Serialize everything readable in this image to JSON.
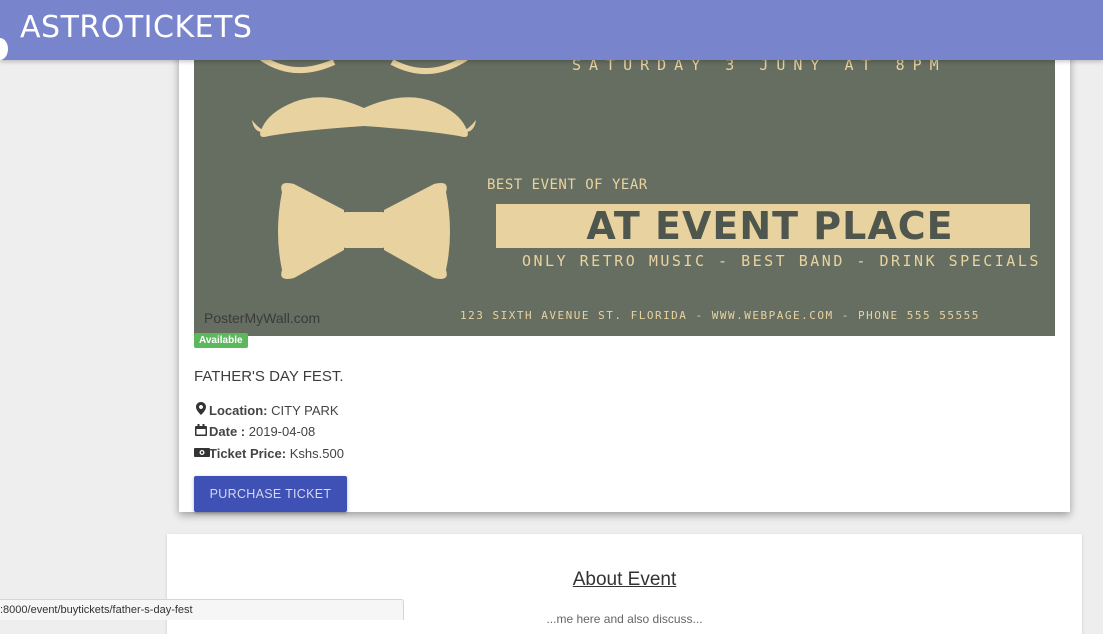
{
  "app": {
    "title": "ASTROTICKETS"
  },
  "event": {
    "poster": {
      "date_line": "SATURDAY 3 JUNY AT 8PM",
      "best": "BEST EVENT OF YEAR",
      "headline": "AT EVENT PLACE",
      "sub": "ONLY RETRO MUSIC - BEST BAND - DRINK SPECIALS",
      "address": "123 SIXTH AVENUE ST. FLORIDA - WWW.WEBPAGE.COM - PHONE 555 55555",
      "watermark": "PosterMyWall.com"
    },
    "status_badge": "Available",
    "name": "FATHER'S DAY FEST.",
    "location_label": "Location:",
    "location_value": "CITY PARK",
    "date_label": "Date :",
    "date_value": "2019-04-08",
    "price_label": "Ticket Price:",
    "price_value": "Kshs.500",
    "purchase_button": "PURCHASE TICKET"
  },
  "about": {
    "heading": "About Event",
    "text": "...me here and also discuss..."
  },
  "status_url": ":8000/event/buytickets/father-s-day-fest",
  "icons": {
    "location": "map-marker-icon",
    "date": "calendar-icon",
    "price": "money-icon"
  },
  "colors": {
    "topbar": "#7884cc",
    "button": "#3f51b5",
    "badge": "#5cb85c",
    "poster_bg": "#666e61",
    "poster_accent": "#e8d3a0"
  }
}
